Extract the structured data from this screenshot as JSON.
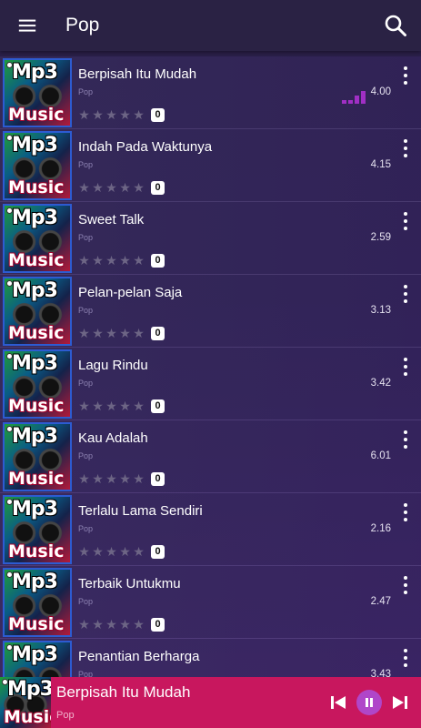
{
  "header": {
    "title": "Pop",
    "menu_icon": "menu-icon",
    "search_icon": "search-icon"
  },
  "songs": [
    {
      "title": "Berpisah Itu Mudah",
      "genre": "Pop",
      "duration": "4.00",
      "rating_count": "0",
      "playing": true
    },
    {
      "title": "Indah Pada Waktunya",
      "genre": "Pop",
      "duration": "4.15",
      "rating_count": "0",
      "playing": false
    },
    {
      "title": "Sweet Talk",
      "genre": "Pop",
      "duration": "2.59",
      "rating_count": "0",
      "playing": false
    },
    {
      "title": "Pelan-pelan Saja",
      "genre": "Pop",
      "duration": "3.13",
      "rating_count": "0",
      "playing": false
    },
    {
      "title": "Lagu Rindu",
      "genre": "Pop",
      "duration": "3.42",
      "rating_count": "0",
      "playing": false
    },
    {
      "title": "Kau Adalah",
      "genre": "Pop",
      "duration": "6.01",
      "rating_count": "0",
      "playing": false
    },
    {
      "title": "Terlalu Lama Sendiri",
      "genre": "Pop",
      "duration": "2.16",
      "rating_count": "0",
      "playing": false
    },
    {
      "title": "Terbaik Untukmu",
      "genre": "Pop",
      "duration": "2.47",
      "rating_count": "0",
      "playing": false
    },
    {
      "title": " Penantian Berharga",
      "genre": "Pop",
      "duration": "3.43",
      "rating_count": "0",
      "playing": false
    }
  ],
  "album_art": {
    "line1": "Mp3",
    "line2": "Music"
  },
  "now_playing": {
    "title": "Berpisah Itu Mudah",
    "genre": "Pop",
    "state": "playing"
  },
  "colors": {
    "app_bar": "#2a2244",
    "now_playing_bar": "#c8175e",
    "accent": "#a02fc4"
  }
}
